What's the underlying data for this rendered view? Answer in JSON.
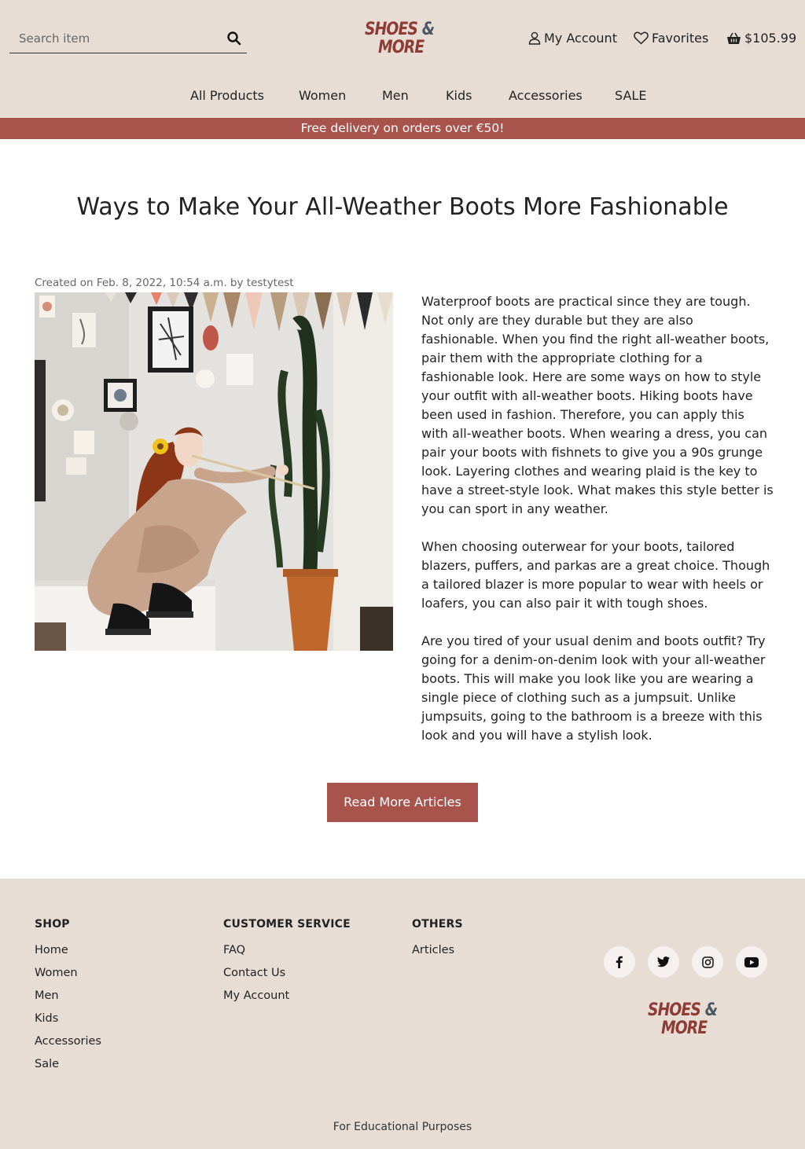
{
  "search": {
    "placeholder": "Search item"
  },
  "brand": {
    "line1": "SHOES",
    "amp": "&",
    "line2": "MORE"
  },
  "header": {
    "account_label": "My Account",
    "favorites_label": "Favorites",
    "cart_total": "$105.99"
  },
  "nav": {
    "items": [
      "All Products",
      "Women",
      "Men",
      "Kids",
      "Accessories",
      "SALE"
    ]
  },
  "promo": {
    "text": "Free delivery on orders over €50!"
  },
  "article": {
    "title": "Ways to Make Your All-Weather Boots More Fashionable",
    "meta": "Created on Feb. 8, 2022, 10:54 a.m. by testytest",
    "paragraphs": [
      "Waterproof boots are practical since they are tough. Not only are they durable but they are also fashionable. When you find the right all-weather boots, pair them with the appropriate clothing for a fashionable look. Here are some ways on how to style your outfit with all-weather boots. Hiking boots have been used in fashion. Therefore, you can apply this with all-weather boots. When wearing a dress, you can pair your boots with fishnets to give you a 90s grunge look. Layering clothes and wearing plaid is the key to have a street-style look. What makes this style better is you can sport in any weather.",
      "When choosing outerwear for your boots, tailored blazers, puffers, and parkas are a great choice. Though a tailored blazer is more popular to wear with heels or loafers, you can also pair it with tough shoes.",
      "Are you tired of your usual denim and boots outfit? Try going for a denim-on-denim look with your all-weather boots. This will make you look like you are wearing a single piece of clothing such as a jumpsuit. Unlike jumpsuits, going to the bathroom is a breeze with this look and you will have a stylish look."
    ],
    "read_more_label": "Read More Articles"
  },
  "footer": {
    "shop": {
      "heading": "SHOP",
      "links": [
        "Home",
        "Women",
        "Men",
        "Kids",
        "Accessories",
        "Sale"
      ]
    },
    "customer_service": {
      "heading": "CUSTOMER SERVICE",
      "links": [
        "FAQ",
        "Contact Us",
        "My Account"
      ]
    },
    "others": {
      "heading": "OTHERS",
      "links": [
        "Articles"
      ]
    },
    "social_icons": [
      "facebook-icon",
      "twitter-icon",
      "instagram-icon",
      "youtube-icon"
    ],
    "note": "For Educational Purposes"
  },
  "colors": {
    "accent": "#a8544d",
    "background": "#e8ddd5",
    "logo_red": "#8e3b35",
    "logo_slate": "#4b5663"
  }
}
